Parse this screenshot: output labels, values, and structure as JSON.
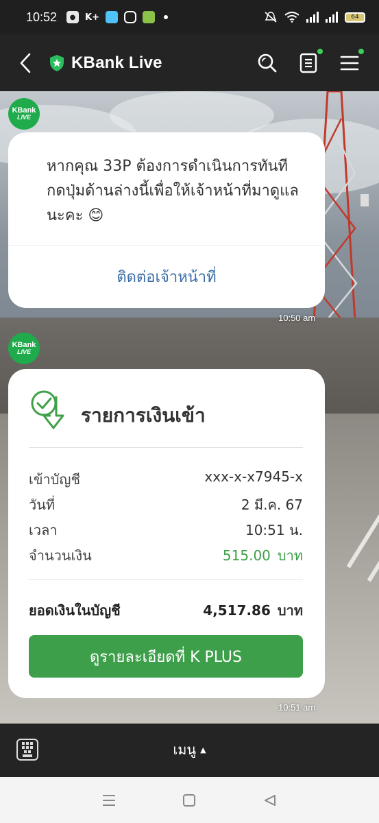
{
  "status_bar": {
    "time": "10:52",
    "kplus_label": "K+",
    "battery": "64"
  },
  "header": {
    "title": "KBank Live"
  },
  "avatar": {
    "line1": "KBank",
    "line2": "LIVE"
  },
  "messages": [
    {
      "text": "หากคุณ 33P ต้องการดำเนินการทันที กดปุ่มด้านล่างนี้เพื่อให้เจ้าหน้าที่มาดูแลนะคะ 😊",
      "link_label": "ติดต่อเจ้าหน้าที่",
      "time": "10:50 am"
    },
    {
      "title": "รายการเงินเข้า",
      "rows": [
        {
          "label": "เข้าบัญชี",
          "value": "xxx-x-x7945-x"
        },
        {
          "label": "วันที่",
          "value": "2 มี.ค. 67"
        },
        {
          "label": "เวลา",
          "value": "10:51  น."
        },
        {
          "label": "จำนวนเงิน",
          "value": "515.00",
          "unit": "บาท"
        }
      ],
      "balance_label": "ยอดเงินในบัญชี",
      "balance_value": "4,517.86",
      "balance_unit": "บาท",
      "button_label": "ดูรายละเอียดที่ K PLUS",
      "time": "10:51 am"
    }
  ],
  "menu_bar": {
    "menu_label": "เมนู"
  },
  "colors": {
    "brand_green": "#1faa4b",
    "button_green": "#3e9f4b",
    "amount_green": "#3ea047",
    "link_blue": "#3b6ea6"
  }
}
